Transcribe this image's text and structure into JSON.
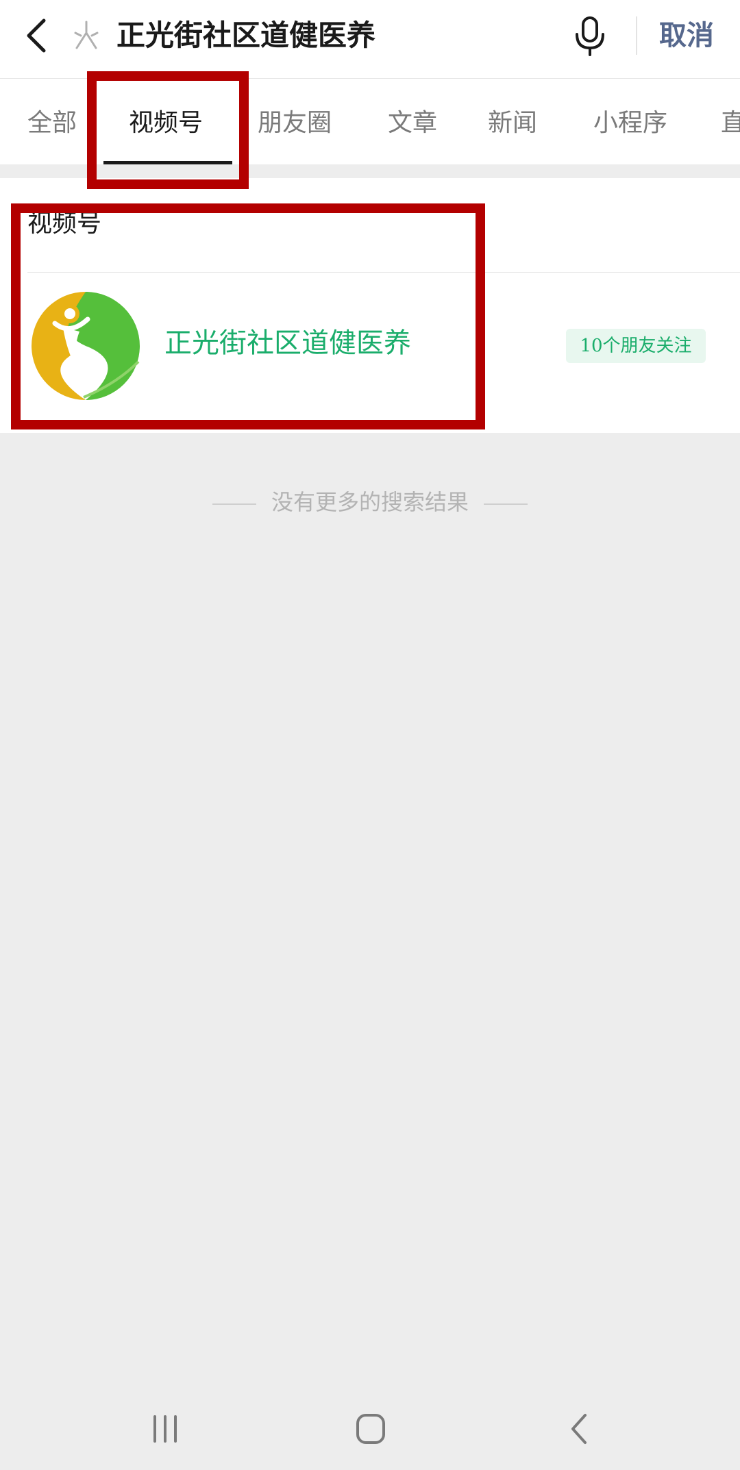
{
  "header": {
    "query": "正光街社区道健医养",
    "cancel_label": "取消"
  },
  "tabs": [
    {
      "label": "全部"
    },
    {
      "label": "视频号"
    },
    {
      "label": "朋友圈"
    },
    {
      "label": "文章"
    },
    {
      "label": "新闻"
    },
    {
      "label": "小程序"
    },
    {
      "label": "直"
    }
  ],
  "active_tab": "视频号",
  "section": {
    "title": "视频号",
    "result": {
      "name": "正光街社区道健医养",
      "friends_badge": "10个朋友关注"
    }
  },
  "end_note": "没有更多的搜索结果",
  "colors": {
    "highlight": "#b30000",
    "accent_green": "#1aad6b",
    "cancel_blue": "#56688d",
    "page_bg": "#ededed"
  },
  "icons": [
    "back-icon",
    "search-icon",
    "microphone-icon",
    "recents-icon",
    "home-icon",
    "nav-back-icon"
  ]
}
